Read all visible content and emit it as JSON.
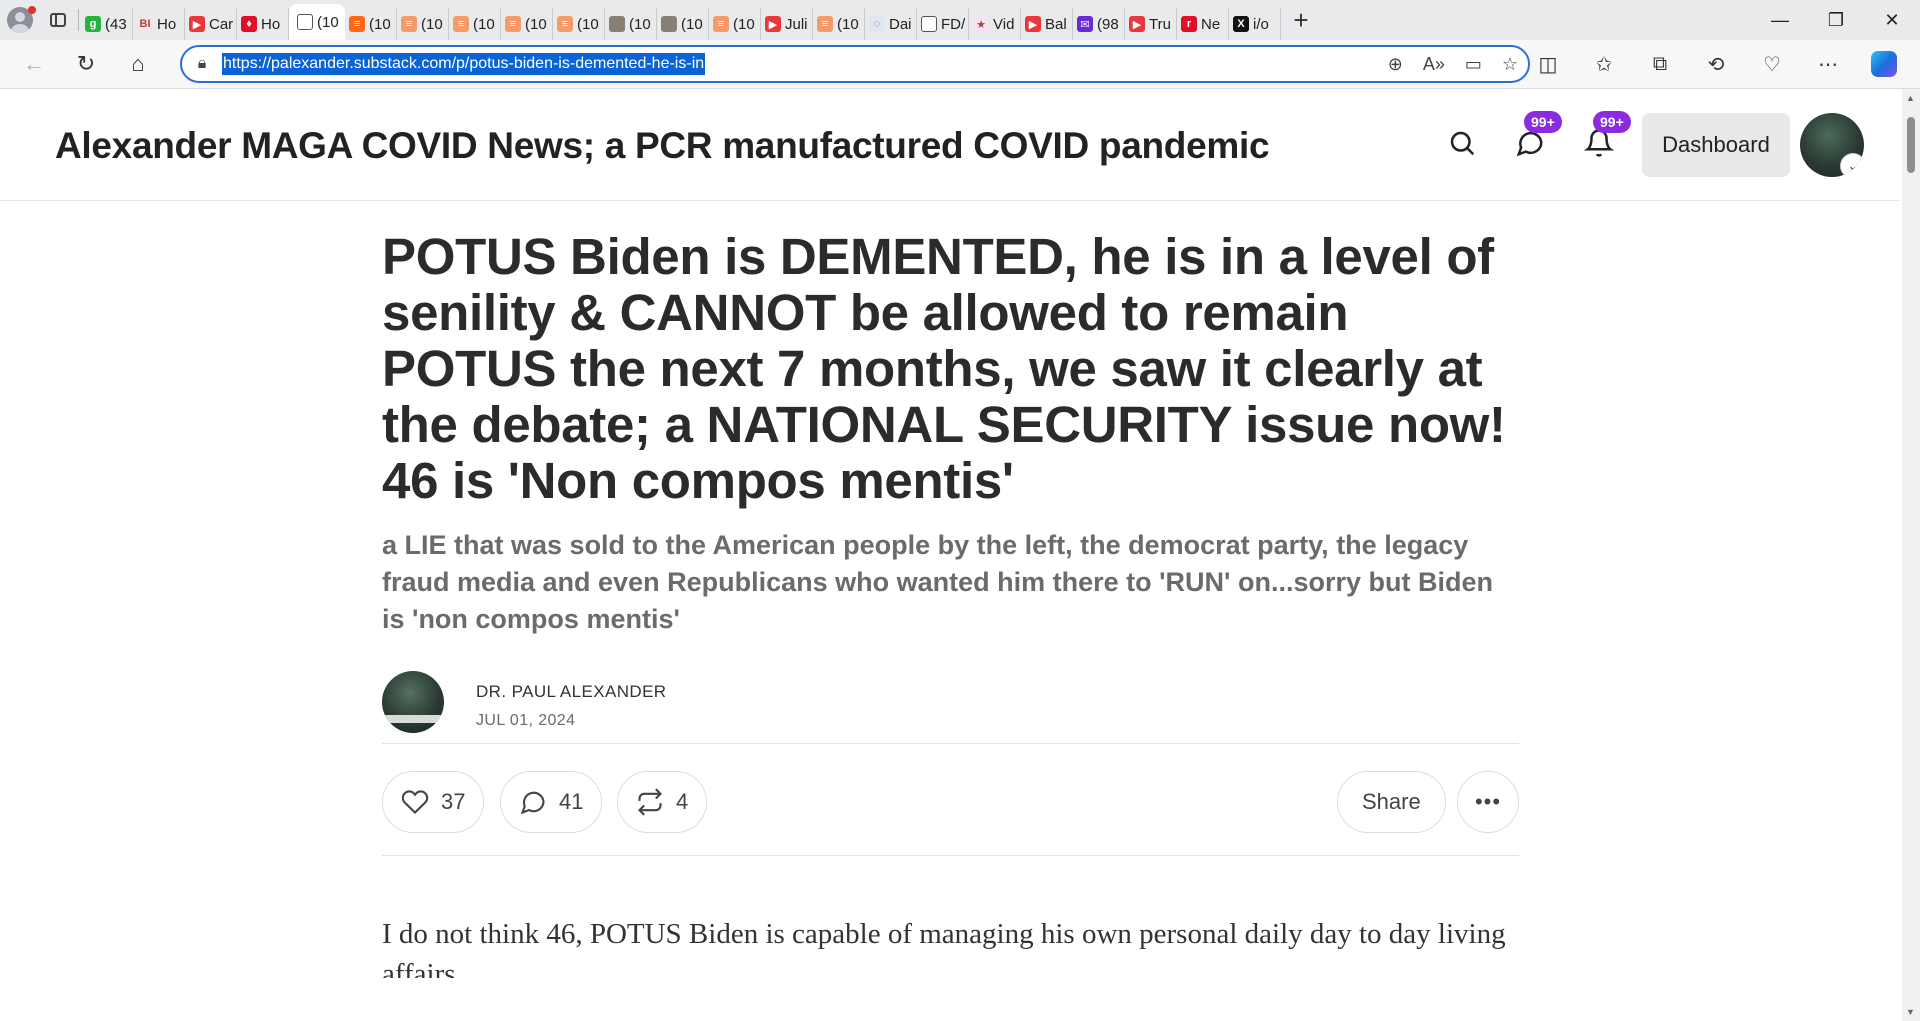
{
  "browser": {
    "tabs": [
      {
        "label": "(43",
        "icon": "g-icon",
        "color": "#25b33a",
        "glyph": "g"
      },
      {
        "label": "Ho",
        "icon": "bi-icon",
        "color": "#f1e7e7",
        "glyph": "BI"
      },
      {
        "label": "Car",
        "icon": "youtube-icon",
        "color": "#e8383d",
        "glyph": "▶"
      },
      {
        "label": "Ho",
        "icon": "red-badge-icon",
        "color": "#e0102a",
        "glyph": "♦"
      },
      {
        "label": "(10",
        "icon": "page-icon",
        "color": "#ffffff",
        "glyph": ""
      },
      {
        "label": "(10",
        "icon": "substack-icon",
        "color": "#ff6719",
        "glyph": "≡"
      },
      {
        "label": "(10",
        "icon": "substack-icon",
        "color": "#f39b6a",
        "glyph": "≡"
      },
      {
        "label": "(10",
        "icon": "substack-icon",
        "color": "#f39b6a",
        "glyph": "≡"
      },
      {
        "label": "(10",
        "icon": "substack-icon",
        "color": "#f39b6a",
        "glyph": "≡"
      },
      {
        "label": "(10",
        "icon": "substack-icon",
        "color": "#f39b6a",
        "glyph": "≡"
      },
      {
        "label": "(10",
        "icon": "photo-icon",
        "color": "#8a7f75",
        "glyph": ""
      },
      {
        "label": "(10",
        "icon": "photo-icon",
        "color": "#8a7f75",
        "glyph": ""
      },
      {
        "label": "(10",
        "icon": "substack-icon",
        "color": "#f39b6a",
        "glyph": "≡"
      },
      {
        "label": "Juli",
        "icon": "youtube-icon",
        "color": "#e8383d",
        "glyph": "▶"
      },
      {
        "label": "(10",
        "icon": "substack-icon",
        "color": "#f39b6a",
        "glyph": "≡"
      },
      {
        "label": "Dai",
        "icon": "globe-icon",
        "color": "#dfe6f2",
        "glyph": "◌"
      },
      {
        "label": "FD/",
        "icon": "page-icon",
        "color": "#ffffff",
        "glyph": ""
      },
      {
        "label": "Vid",
        "icon": "star-icon",
        "color": "#f3e3f3",
        "glyph": "★"
      },
      {
        "label": "Bal",
        "icon": "youtube-icon",
        "color": "#e8383d",
        "glyph": "▶"
      },
      {
        "label": "(98",
        "icon": "mail-icon",
        "color": "#6a2bd6",
        "glyph": "✉"
      },
      {
        "label": "Tru",
        "icon": "youtube-icon",
        "color": "#e8383d",
        "glyph": "▶"
      },
      {
        "label": "Ne",
        "icon": "r-icon",
        "color": "#e0102a",
        "glyph": "r"
      },
      {
        "label": "i/o",
        "icon": "x-icon",
        "color": "#111111",
        "glyph": "X"
      }
    ],
    "url": "https://palexander.substack.com/p/potus-biden-is-demented-he-is-in"
  },
  "site": {
    "title": "Alexander MAGA COVID News; a PCR manufactured COVID pandemic",
    "chat_badge": "99+",
    "notif_badge": "99+",
    "dashboard_label": "Dashboard"
  },
  "article": {
    "headline": "POTUS Biden is DEMENTED, he is in a level of senility & CANNOT be allowed to remain POTUS the next 7 months, we saw it clearly at the debate; a NATIONAL SECURITY issue now! 46 is 'Non compos mentis'",
    "subtitle": "a LIE that was sold to the American people by the left, the democrat party, the legacy fraud media and even Republicans who wanted him there to 'RUN' on...sorry but Biden is 'non compos mentis'",
    "author": "DR. PAUL ALEXANDER",
    "date": "JUL 01, 2024",
    "likes": "37",
    "comments": "41",
    "restacks": "4",
    "share_label": "Share",
    "body_start": "I do not think 46, POTUS Biden is capable of managing his own personal daily day to day living affairs."
  }
}
